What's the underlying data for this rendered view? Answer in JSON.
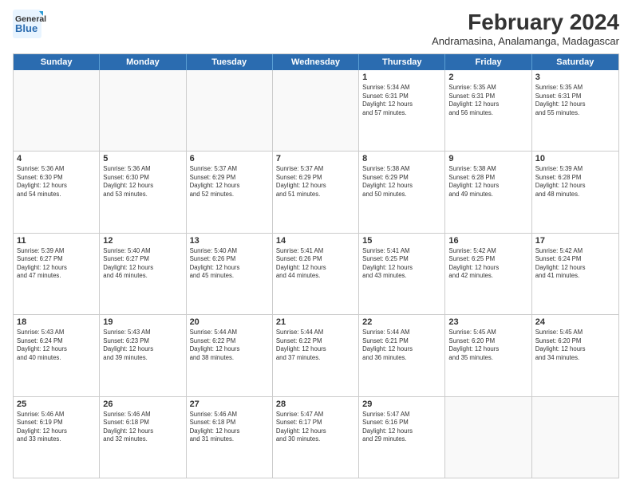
{
  "logo": {
    "line1": "General",
    "line2": "Blue"
  },
  "title": "February 2024",
  "subtitle": "Andramasina, Analamanga, Madagascar",
  "header_days": [
    "Sunday",
    "Monday",
    "Tuesday",
    "Wednesday",
    "Thursday",
    "Friday",
    "Saturday"
  ],
  "weeks": [
    [
      {
        "day": "",
        "info": ""
      },
      {
        "day": "",
        "info": ""
      },
      {
        "day": "",
        "info": ""
      },
      {
        "day": "",
        "info": ""
      },
      {
        "day": "1",
        "info": "Sunrise: 5:34 AM\nSunset: 6:31 PM\nDaylight: 12 hours\nand 57 minutes."
      },
      {
        "day": "2",
        "info": "Sunrise: 5:35 AM\nSunset: 6:31 PM\nDaylight: 12 hours\nand 56 minutes."
      },
      {
        "day": "3",
        "info": "Sunrise: 5:35 AM\nSunset: 6:31 PM\nDaylight: 12 hours\nand 55 minutes."
      }
    ],
    [
      {
        "day": "4",
        "info": "Sunrise: 5:36 AM\nSunset: 6:30 PM\nDaylight: 12 hours\nand 54 minutes."
      },
      {
        "day": "5",
        "info": "Sunrise: 5:36 AM\nSunset: 6:30 PM\nDaylight: 12 hours\nand 53 minutes."
      },
      {
        "day": "6",
        "info": "Sunrise: 5:37 AM\nSunset: 6:29 PM\nDaylight: 12 hours\nand 52 minutes."
      },
      {
        "day": "7",
        "info": "Sunrise: 5:37 AM\nSunset: 6:29 PM\nDaylight: 12 hours\nand 51 minutes."
      },
      {
        "day": "8",
        "info": "Sunrise: 5:38 AM\nSunset: 6:29 PM\nDaylight: 12 hours\nand 50 minutes."
      },
      {
        "day": "9",
        "info": "Sunrise: 5:38 AM\nSunset: 6:28 PM\nDaylight: 12 hours\nand 49 minutes."
      },
      {
        "day": "10",
        "info": "Sunrise: 5:39 AM\nSunset: 6:28 PM\nDaylight: 12 hours\nand 48 minutes."
      }
    ],
    [
      {
        "day": "11",
        "info": "Sunrise: 5:39 AM\nSunset: 6:27 PM\nDaylight: 12 hours\nand 47 minutes."
      },
      {
        "day": "12",
        "info": "Sunrise: 5:40 AM\nSunset: 6:27 PM\nDaylight: 12 hours\nand 46 minutes."
      },
      {
        "day": "13",
        "info": "Sunrise: 5:40 AM\nSunset: 6:26 PM\nDaylight: 12 hours\nand 45 minutes."
      },
      {
        "day": "14",
        "info": "Sunrise: 5:41 AM\nSunset: 6:26 PM\nDaylight: 12 hours\nand 44 minutes."
      },
      {
        "day": "15",
        "info": "Sunrise: 5:41 AM\nSunset: 6:25 PM\nDaylight: 12 hours\nand 43 minutes."
      },
      {
        "day": "16",
        "info": "Sunrise: 5:42 AM\nSunset: 6:25 PM\nDaylight: 12 hours\nand 42 minutes."
      },
      {
        "day": "17",
        "info": "Sunrise: 5:42 AM\nSunset: 6:24 PM\nDaylight: 12 hours\nand 41 minutes."
      }
    ],
    [
      {
        "day": "18",
        "info": "Sunrise: 5:43 AM\nSunset: 6:24 PM\nDaylight: 12 hours\nand 40 minutes."
      },
      {
        "day": "19",
        "info": "Sunrise: 5:43 AM\nSunset: 6:23 PM\nDaylight: 12 hours\nand 39 minutes."
      },
      {
        "day": "20",
        "info": "Sunrise: 5:44 AM\nSunset: 6:22 PM\nDaylight: 12 hours\nand 38 minutes."
      },
      {
        "day": "21",
        "info": "Sunrise: 5:44 AM\nSunset: 6:22 PM\nDaylight: 12 hours\nand 37 minutes."
      },
      {
        "day": "22",
        "info": "Sunrise: 5:44 AM\nSunset: 6:21 PM\nDaylight: 12 hours\nand 36 minutes."
      },
      {
        "day": "23",
        "info": "Sunrise: 5:45 AM\nSunset: 6:20 PM\nDaylight: 12 hours\nand 35 minutes."
      },
      {
        "day": "24",
        "info": "Sunrise: 5:45 AM\nSunset: 6:20 PM\nDaylight: 12 hours\nand 34 minutes."
      }
    ],
    [
      {
        "day": "25",
        "info": "Sunrise: 5:46 AM\nSunset: 6:19 PM\nDaylight: 12 hours\nand 33 minutes."
      },
      {
        "day": "26",
        "info": "Sunrise: 5:46 AM\nSunset: 6:18 PM\nDaylight: 12 hours\nand 32 minutes."
      },
      {
        "day": "27",
        "info": "Sunrise: 5:46 AM\nSunset: 6:18 PM\nDaylight: 12 hours\nand 31 minutes."
      },
      {
        "day": "28",
        "info": "Sunrise: 5:47 AM\nSunset: 6:17 PM\nDaylight: 12 hours\nand 30 minutes."
      },
      {
        "day": "29",
        "info": "Sunrise: 5:47 AM\nSunset: 6:16 PM\nDaylight: 12 hours\nand 29 minutes."
      },
      {
        "day": "",
        "info": ""
      },
      {
        "day": "",
        "info": ""
      }
    ]
  ]
}
